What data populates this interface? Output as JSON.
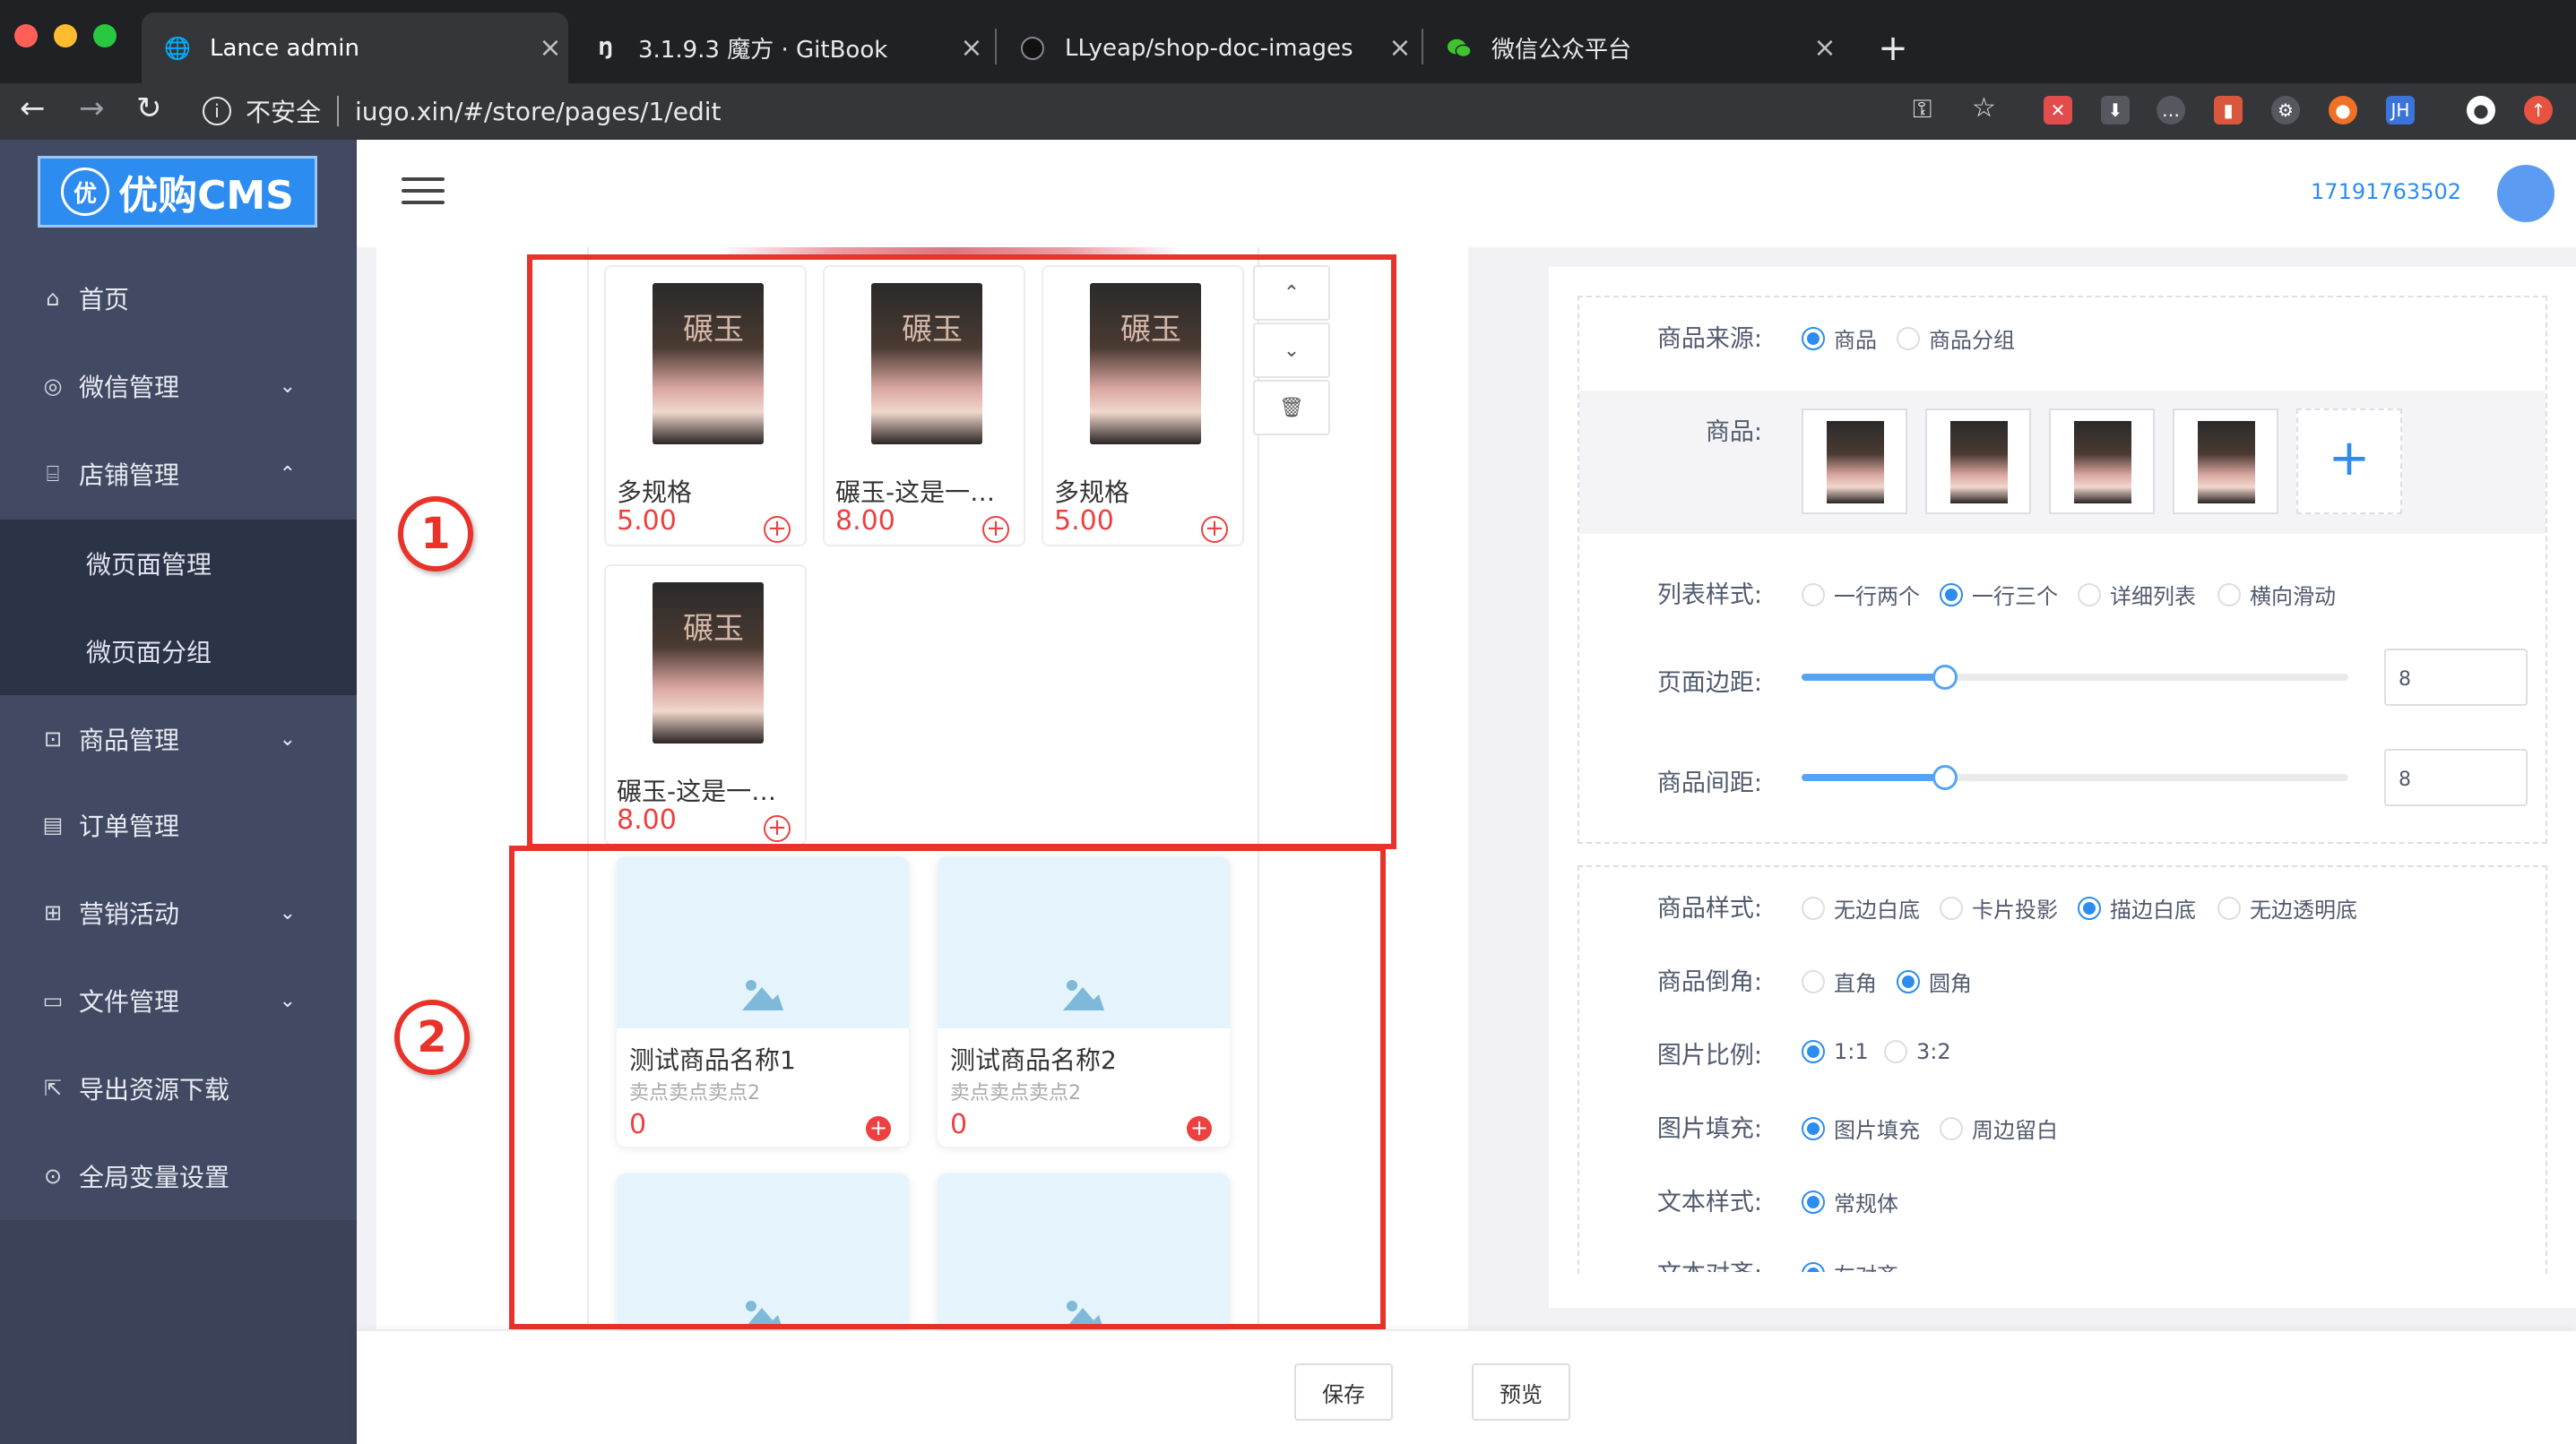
{
  "browser": {
    "tabs": [
      {
        "title": "Lance admin",
        "icon": "globe-icon",
        "active": true
      },
      {
        "title": "3.1.9.3 魔方 · GitBook",
        "icon": "gitbook-icon",
        "active": false
      },
      {
        "title": "LLyeap/shop-doc-images",
        "icon": "github-icon",
        "active": false
      },
      {
        "title": "微信公众平台",
        "icon": "wechat-icon",
        "active": false
      }
    ],
    "security_label": "不安全",
    "url": "iugo.xin/#/store/pages/1/edit"
  },
  "sidebar": {
    "logo_text": "优购CMS",
    "logo_badge": "优",
    "items": [
      {
        "label": "首页",
        "icon": "home-icon",
        "arrow": ""
      },
      {
        "label": "微信管理",
        "icon": "wechat-icon",
        "arrow": "⌄"
      },
      {
        "label": "店铺管理",
        "icon": "store-icon",
        "arrow": "⌃"
      },
      {
        "label": "商品管理",
        "icon": "bag-icon",
        "arrow": "⌄"
      },
      {
        "label": "订单管理",
        "icon": "order-icon",
        "arrow": ""
      },
      {
        "label": "营销活动",
        "icon": "gift-icon",
        "arrow": "⌄"
      },
      {
        "label": "文件管理",
        "icon": "folder-icon",
        "arrow": "⌄"
      },
      {
        "label": "导出资源下载",
        "icon": "export-icon",
        "arrow": ""
      },
      {
        "label": "全局变量设置",
        "icon": "settings-icon",
        "arrow": ""
      }
    ],
    "subitems": [
      {
        "label": "微页面管理"
      },
      {
        "label": "微页面分组"
      }
    ]
  },
  "header": {
    "username": "17191763502"
  },
  "preview": {
    "products": [
      {
        "name": "多规格",
        "price": "5.00"
      },
      {
        "name": "碾玉-这是一…",
        "price": "8.00"
      },
      {
        "name": "多规格",
        "price": "5.00"
      },
      {
        "name": "碾玉-这是一…",
        "price": "8.00"
      }
    ],
    "cover_text": "碾玉",
    "annotations": [
      "1",
      "2"
    ],
    "sample_products": [
      {
        "name": "测试商品名称1",
        "desc": "卖点卖点卖点2",
        "price": "0"
      },
      {
        "name": "测试商品名称2",
        "desc": "卖点卖点卖点2",
        "price": "0"
      }
    ]
  },
  "footer": {
    "save_label": "保存",
    "preview_label": "预览"
  },
  "settings": {
    "source_label": "商品来源:",
    "source_options": [
      "商品",
      "商品分组"
    ],
    "goods_label": "商品:",
    "list_style_label": "列表样式:",
    "list_style_options": [
      "一行两个",
      "一行三个",
      "详细列表",
      "横向滑动"
    ],
    "page_margin_label": "页面边距:",
    "page_margin_value": "8",
    "goods_gap_label": "商品间距:",
    "goods_gap_value": "8",
    "goods_style_label": "商品样式:",
    "goods_style_options": [
      "无边白底",
      "卡片投影",
      "描边白底",
      "无边透明底"
    ],
    "corner_label": "商品倒角:",
    "corner_options": [
      "直角",
      "圆角"
    ],
    "ratio_label": "图片比例:",
    "ratio_options": [
      "1:1",
      "3:2"
    ],
    "fill_label": "图片填充:",
    "fill_options": [
      "图片填充",
      "周边留白"
    ],
    "text_style_label": "文本样式:",
    "text_style_options": [
      "常规体"
    ],
    "text_align_label": "文本对齐:",
    "text_align_options": [
      "左对齐"
    ]
  }
}
